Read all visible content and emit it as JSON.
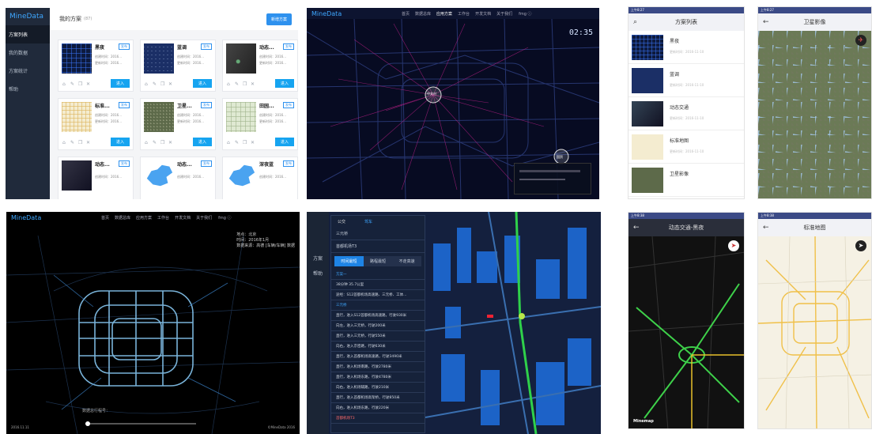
{
  "t1": {
    "logo": "MineData",
    "nav": [
      "方案列表",
      "我的数据",
      "方案统计",
      "帮助"
    ],
    "header": "我的方案",
    "count": "(87)",
    "new_button": "新增方案",
    "cards": [
      {
        "title": "黑夜",
        "badge": "发布",
        "meta": [
          "创建时间：2016...",
          "更新时间：2016..."
        ],
        "enter": "进入"
      },
      {
        "title": "蓝调",
        "badge": "发布",
        "meta": [
          "创建时间：2016...",
          "更新时间：2016..."
        ],
        "enter": "进入"
      },
      {
        "title": "动态...",
        "badge": "发布",
        "meta": [
          "创建时间：2016...",
          "更新时间：2016..."
        ],
        "enter": "进入"
      },
      {
        "title": "标准...",
        "badge": "发布",
        "meta": [
          "创建时间：2016...",
          "更新时间：2016..."
        ],
        "enter": "进入"
      },
      {
        "title": "卫星...",
        "badge": "发布",
        "meta": [
          "创建时间：2016...",
          "更新时间：2016..."
        ],
        "enter": "进入"
      },
      {
        "title": "田园...",
        "badge": "发布",
        "meta": [
          "创建时间：2016...",
          "更新时间：2016..."
        ],
        "enter": "进入"
      },
      {
        "title": "动态...",
        "badge": "发布",
        "meta": [
          "创建时间：2016..."
        ],
        "enter": ""
      },
      {
        "title": "动态...",
        "badge": "发布",
        "meta": [
          "创建时间：2016..."
        ],
        "enter": ""
      },
      {
        "title": "深夜蓝",
        "badge": "发布",
        "meta": [
          "创建时间：2016..."
        ],
        "enter": ""
      }
    ]
  },
  "t2": {
    "brand": "MineData",
    "menu": [
      "首页",
      "数据总库",
      "应用方案",
      "工作台",
      "开发文档",
      "关于我们"
    ],
    "user": "fmg ⓘ",
    "clock": "02:35",
    "marker1": "中关村",
    "marker2": "国贸"
  },
  "t3": {
    "brand": "MineData",
    "menu": [
      "首页",
      "数据总库",
      "应用方案",
      "工作台",
      "开发文档",
      "关于我们"
    ],
    "user": "fmg ⓘ",
    "info": [
      "地点：北京",
      "时间：2016年1月",
      "数据来源：高德 [车辆/车辆] 数据"
    ],
    "slider_label": "数据总行程号：",
    "date": "2016.11.11",
    "copyright": "©MineData 2016"
  },
  "t4": {
    "side": [
      "方案",
      "帮助"
    ],
    "title": "公交",
    "drive": "驾车",
    "from": "三元桥",
    "to": "首都机场T3",
    "tabs": [
      "时间最短",
      "路程最短",
      "不走高速"
    ],
    "summary": [
      "方案一",
      "38分钟  35.7公里",
      "途经：S12首都机场高速路、三元桥、工体..."
    ],
    "start": "三元桥",
    "steps": [
      "直行，进入S12首都机场高速路，行驶930米",
      "向左，进入三元桥，行驶200米",
      "直行，进入三元桥，行驶550米",
      "向右，进入京密路，行驶630米",
      "直行，进入首都机场高速路，行驶3490米",
      "直行，进入机场南路，行驶2780米",
      "直行，进入机场东路，行驶4780米",
      "向右，进入机场辅路，行驶210米",
      "直行，进入首都机场高架桥，行驶850米",
      "向右，进入机场东路，行驶220米"
    ],
    "end": "首都机场T3"
  },
  "p1": {
    "status": "上午8:27",
    "title": "方案列表",
    "items": [
      {
        "name": "黑夜",
        "date": "更新时间：2016-11-10"
      },
      {
        "name": "蓝调",
        "date": "更新时间：2016-11-10"
      },
      {
        "name": "动态交通",
        "date": "更新时间：2016-11-10"
      },
      {
        "name": "标准地图",
        "date": "更新时间：2016-11-10"
      },
      {
        "name": "卫星影像",
        "date": ""
      }
    ]
  },
  "p2": {
    "status": "上午8:27",
    "title": "卫星影像"
  },
  "p3": {
    "status": "上午8:38",
    "title": "动态交通-黑夜",
    "logo": "Minemap"
  },
  "p4": {
    "status": "上午8:38",
    "title": "标准地图"
  }
}
